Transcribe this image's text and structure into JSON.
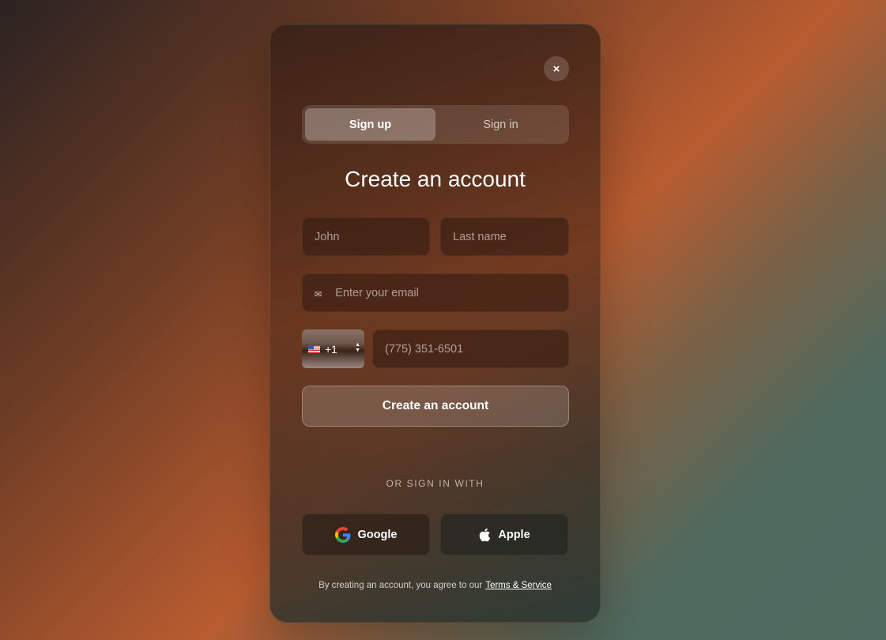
{
  "modal": {
    "close_label": "×",
    "tabs": [
      {
        "label": "Sign up",
        "active": true
      },
      {
        "label": "Sign in",
        "active": false
      }
    ],
    "title": "Create an account",
    "fields": {
      "first_name_placeholder": "John",
      "last_name_placeholder": "Last name",
      "email_placeholder": "Enter your email",
      "email_icon": "envelope-icon",
      "country_code": "+1",
      "country_flag": "us-flag-icon",
      "phone_placeholder": "(775) 351-6501"
    },
    "submit_label": "Create an account",
    "divider_text": "OR SIGN IN WITH",
    "social": [
      {
        "label": "Google",
        "icon": "google-icon"
      },
      {
        "label": "Apple",
        "icon": "apple-icon"
      }
    ],
    "terms_text": "By creating an account, you agree to our",
    "terms_link": "Terms & Service"
  }
}
